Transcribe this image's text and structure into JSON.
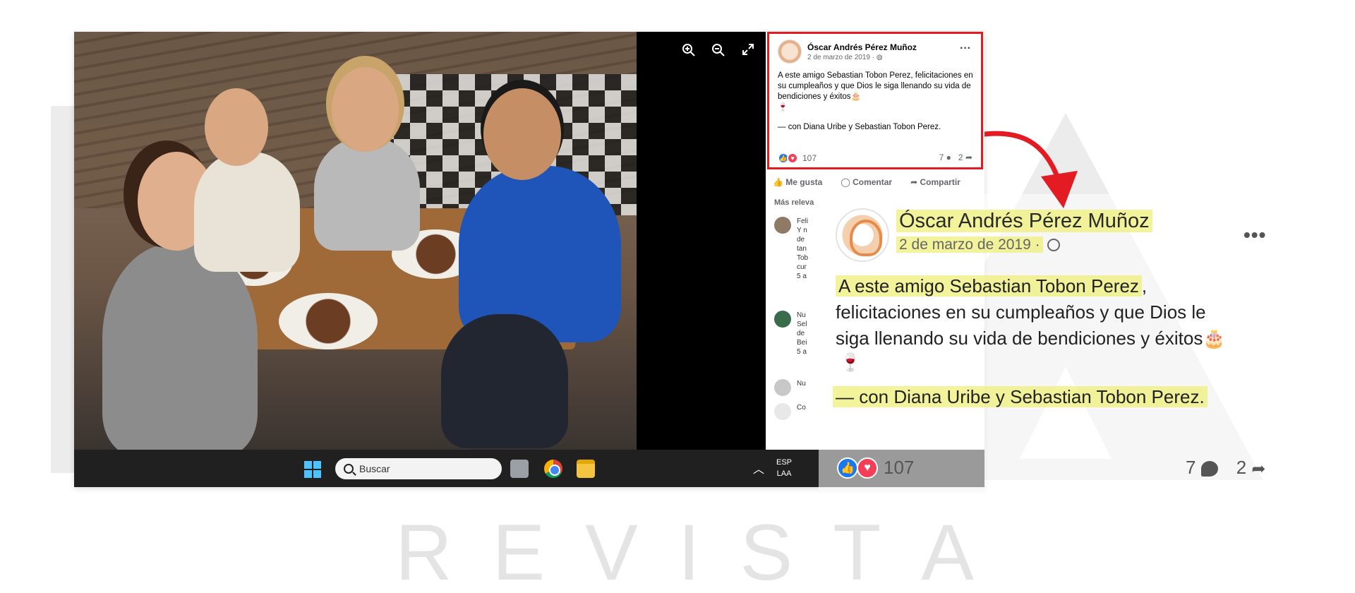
{
  "watermark": {
    "word": [
      "R",
      "E",
      "V",
      "I",
      "S",
      "T",
      "A"
    ]
  },
  "colors": {
    "highlight": "#edef78",
    "callout_border": "#e31b23",
    "facebook_blue": "#1877f2",
    "love_red": "#f33e58",
    "taskbar": "#202020"
  },
  "viewer": {
    "icons": [
      "zoom-in-icon",
      "zoom-out-icon",
      "fullscreen-icon"
    ]
  },
  "post": {
    "author": "Óscar Andrés Pérez Muñoz",
    "date": "2 de marzo de 2019 ·",
    "privacy_icon": "globe-icon",
    "more_icon": "more-dots-icon",
    "text_mention": "A este amigo Sebastian Tobon Perez",
    "text_rest": ", felicitaciones en su cumpleaños y que Dios le siga llenando su vida de bendiciones y éxitos",
    "text_line1_rest": ",",
    "text_line2": "felicitaciones en su cumpleaños y que Dios le",
    "text_line3": "siga llenando su vida de bendiciones y éxitos",
    "emoji_cake": "🎂",
    "emoji_wine": "🍷",
    "with_line": "— con Diana Uribe y Sebastian Tobon Perez.",
    "reactions_count": "107",
    "comments_count": "7",
    "shares_count": "2",
    "actions": {
      "like": "Me gusta",
      "comment": "Comentar",
      "share": "Compartir"
    },
    "relevance_label": "Más releva",
    "comments_fragments": [
      {
        "name": "Feli",
        "lines": [
          "Y n",
          "de",
          "tan",
          "Tob",
          "cur"
        ],
        "time": "5 a"
      },
      {
        "name": "Nu",
        "lines": [
          "Sel",
          "de",
          "Bei"
        ],
        "time": "5 a"
      },
      {
        "name": "Nu",
        "lines": [],
        "time": ""
      },
      {
        "name": "Co",
        "lines": [],
        "time": ""
      }
    ]
  },
  "taskbar": {
    "search_placeholder": "Buscar",
    "language_line1": "ESP",
    "language_line2": "LAA",
    "icons": [
      "windows-start-icon",
      "search-icon",
      "task-view-icon",
      "chrome-icon",
      "file-explorer-icon",
      "chevron-up-icon"
    ]
  }
}
